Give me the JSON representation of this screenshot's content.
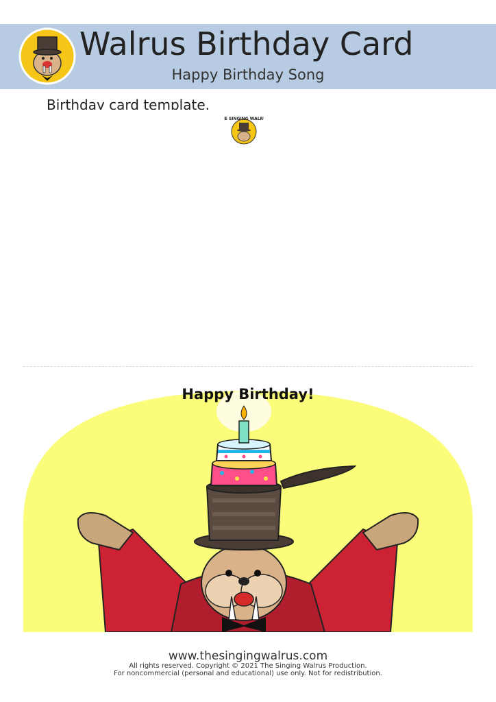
{
  "header": {
    "title": "Walrus Birthday Card",
    "subtitle": "Happy Birthday Song",
    "background_color": "#b7cbe2"
  },
  "intro_text": "Birthday card template.",
  "small_logo": {
    "icon": "singing-walrus-logo-icon",
    "text": "THE SINGING WALRUS"
  },
  "card": {
    "greeting": "Happy Birthday!",
    "background_color": "#fbfc7a",
    "illustration": "walrus-with-top-hat-and-birthday-cake"
  },
  "footer": {
    "url": "www.thesingingwalrus.com",
    "copyright": "All rights reserved. Copyright © 2021 The Singing Walrus Production.",
    "license": "For noncommercial (personal and educational) use only. Not for redistribution."
  }
}
